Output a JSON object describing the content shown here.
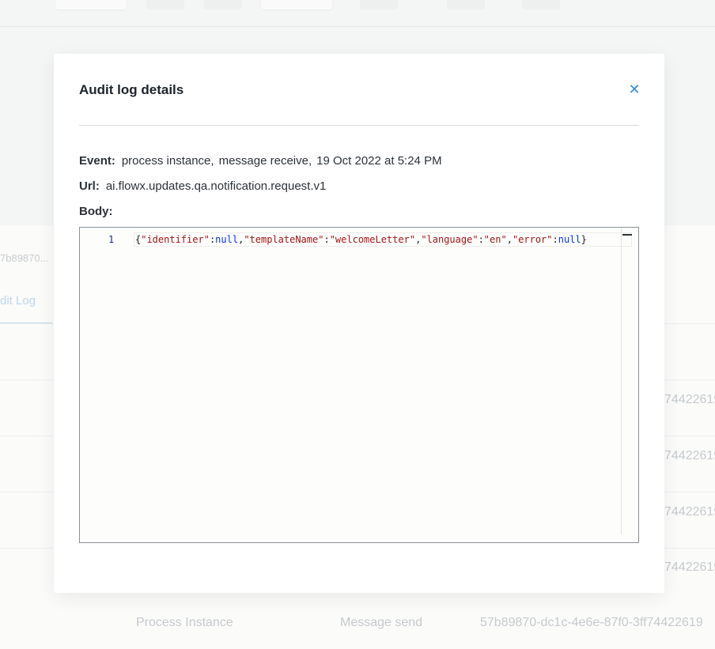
{
  "background": {
    "instance_id_truncated": "7b89870...",
    "tab_label": "dit Log",
    "rows": [
      {
        "col3": "74422619"
      },
      {
        "col3": "74422619"
      },
      {
        "col3": "74422619"
      },
      {
        "col3": "74422619"
      },
      {
        "col1": "Process Instance",
        "col2": "Message send",
        "col3": "57b89870-dc1c-4e6e-87f0-3ff74422619"
      }
    ]
  },
  "modal": {
    "title": "Audit log details",
    "close_icon": "close-icon",
    "event_label": "Event:",
    "event_values": [
      "process instance,",
      "message receive,",
      "19 Oct 2022 at 5:24 PM"
    ],
    "url_label": "Url:",
    "url_value": "ai.flowx.updates.qa.notification.request.v1",
    "body_label": "Body:",
    "editor": {
      "line_number": "1",
      "tokens": [
        {
          "t": "punc",
          "v": "{"
        },
        {
          "t": "key",
          "v": "\"identifier\""
        },
        {
          "t": "punc",
          "v": ":"
        },
        {
          "t": "null",
          "v": "null"
        },
        {
          "t": "punc",
          "v": ","
        },
        {
          "t": "key",
          "v": "\"templateName\""
        },
        {
          "t": "punc",
          "v": ":"
        },
        {
          "t": "str",
          "v": "\"welcomeLetter\""
        },
        {
          "t": "punc",
          "v": ","
        },
        {
          "t": "key",
          "v": "\"language\""
        },
        {
          "t": "punc",
          "v": ":"
        },
        {
          "t": "str",
          "v": "\"en\""
        },
        {
          "t": "punc",
          "v": ","
        },
        {
          "t": "key",
          "v": "\"error\""
        },
        {
          "t": "punc",
          "v": ":"
        },
        {
          "t": "null",
          "v": "null"
        },
        {
          "t": "punc",
          "v": "}"
        }
      ]
    }
  },
  "colors": {
    "accent": "#2f8fd6",
    "json_key": "#a31515",
    "json_null": "#0431fa"
  }
}
